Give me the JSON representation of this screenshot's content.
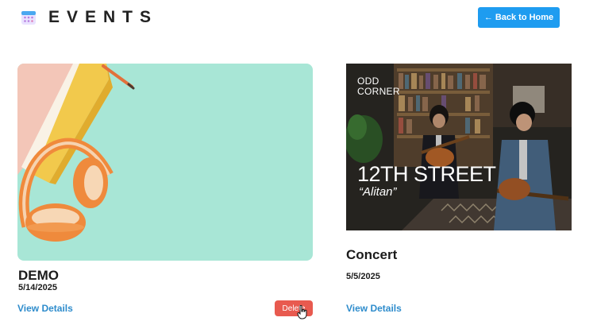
{
  "header": {
    "title": "EVENTS",
    "logo_icon": "calendar-icon",
    "back_button": {
      "arrow": "←",
      "label": "Back to Home"
    }
  },
  "events": [
    {
      "title": "DEMO",
      "date": "5/14/2025",
      "link_label": "View Details",
      "delete_label": "Delete",
      "image_subject": "headphones-books-illustration"
    },
    {
      "title": "Concert",
      "date": "5/5/2025",
      "link_label": "View Details",
      "image_overlay": {
        "brand_line1": "ODD",
        "brand_line2": "CORNER",
        "title": "12TH STREET",
        "subtitle": "“Alitan”"
      }
    }
  ],
  "colors": {
    "accent": "#1e9cf0",
    "link": "#2e8ccc",
    "danger": "#e85a4f",
    "card1_bg": "#a8e6d6"
  }
}
